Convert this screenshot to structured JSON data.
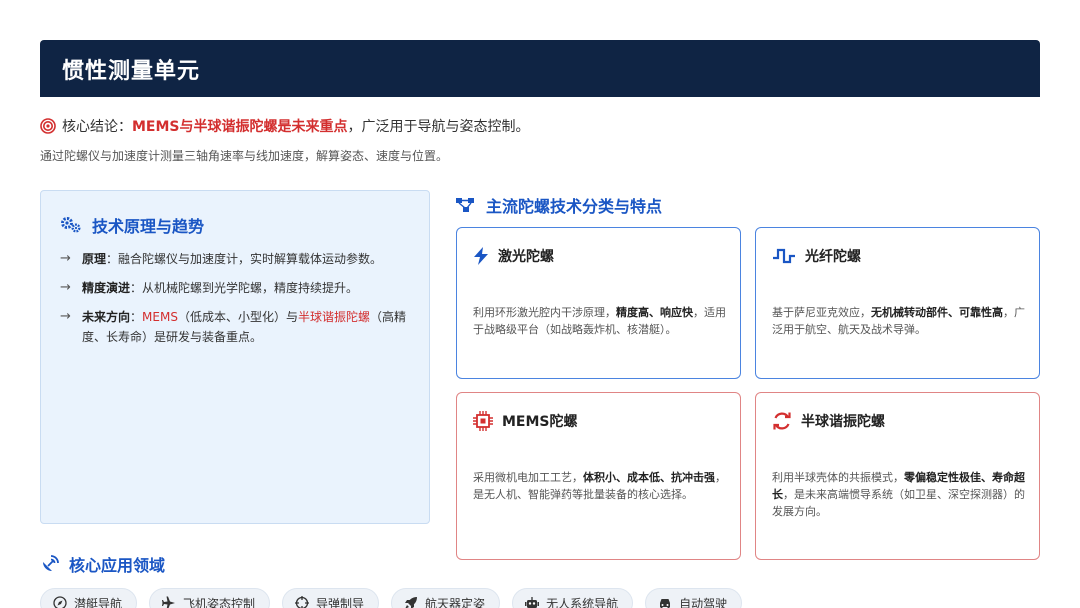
{
  "header": {
    "title": "惯性测量单元"
  },
  "conclusion": {
    "prefix": "核心结论：",
    "highlight": "MEMS与半球谐振陀螺是未来重点",
    "suffix": "，广泛用于导航与姿态控制。"
  },
  "subtitle": "通过陀螺仪与加速度计测量三轴角速率与线加速度，解算姿态、速度与位置。",
  "left_panel": {
    "title": "技术原理与趋势",
    "items": [
      {
        "label": "原理",
        "text": "：融合陀螺仪与加速度计，实时解算载体运动参数。"
      },
      {
        "label": "精度演进",
        "text": "：从机械陀螺到光学陀螺，精度持续提升。"
      },
      {
        "label": "未来方向",
        "sep1": "：",
        "red1": "MEMS",
        "mid": "（低成本、小型化）与",
        "red2": "半球谐振陀螺",
        "end": "（高精度、长寿命）是研发与装备重点。"
      }
    ]
  },
  "right_section": {
    "title": "主流陀螺技术分类与特点",
    "cards": [
      {
        "title": "激光陀螺",
        "icon": "bolt-icon",
        "pre": "利用环形激光腔内干涉原理，",
        "bold": "精度高、响应快",
        "post": "，适用于战略级平台（如战略轰炸机、核潜艇）。"
      },
      {
        "title": "光纤陀螺",
        "icon": "pulse-wave-icon",
        "pre": "基于萨尼亚克效应，",
        "bold": "无机械转动部件、可靠性高",
        "post": "，广泛用于航空、航天及战术导弹。"
      },
      {
        "title": "MEMS陀螺",
        "icon": "chip-icon",
        "pre": "采用微机电加工工艺，",
        "bold": "体积小、成本低、抗冲击强",
        "post": "，是无人机、智能弹药等批量装备的核心选择。"
      },
      {
        "title": "半球谐振陀螺",
        "icon": "sync-icon",
        "pre": "利用半球壳体的共振模式，",
        "bold": "零偏稳定性极佳、寿命超长",
        "post": "，是未来高端惯导系统（如卫星、深空探测器）的发展方向。"
      }
    ]
  },
  "applications": {
    "title": "核心应用领域",
    "tags": [
      "潜艇导航",
      "飞机姿态控制",
      "导弹制导",
      "航天器定姿",
      "无人系统导航",
      "自动驾驶"
    ]
  },
  "colors": {
    "navy": "#0f2444",
    "blue": "#1a56c4",
    "red": "#d32f2f",
    "panel": "#eaf3fd"
  }
}
